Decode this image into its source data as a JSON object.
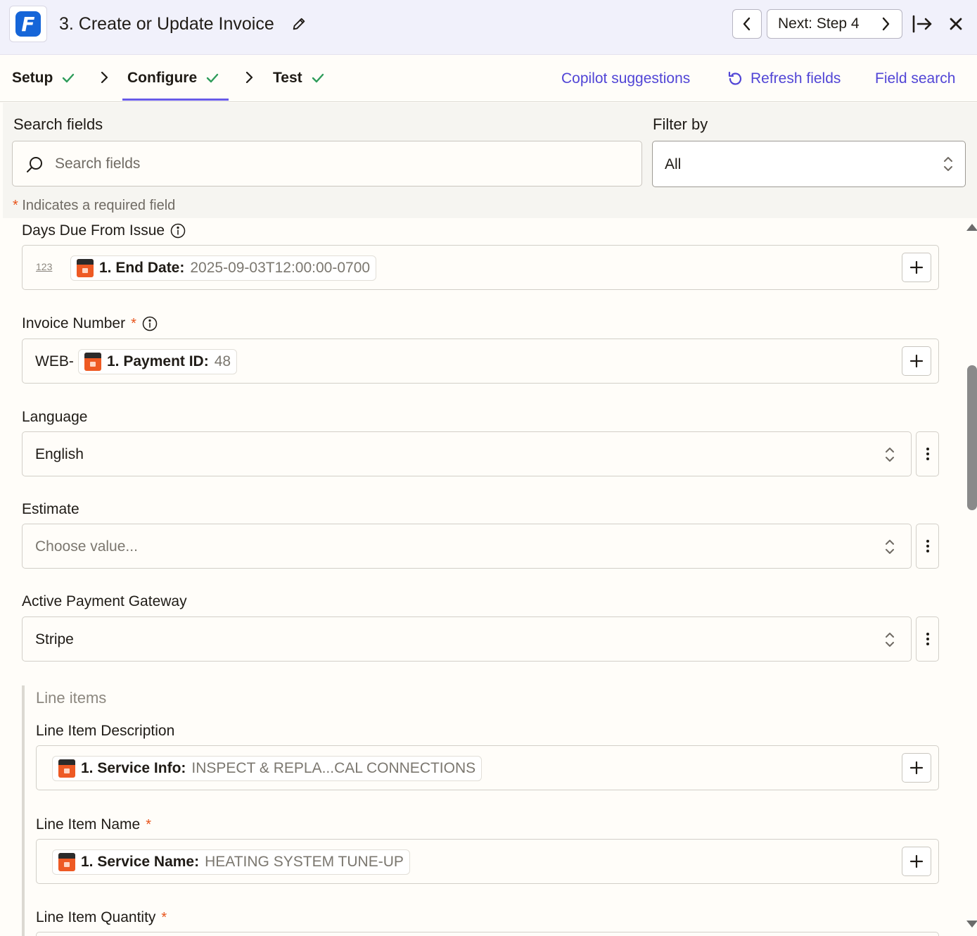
{
  "header": {
    "title": "3. Create or Update Invoice",
    "next_label": "Next: Step 4",
    "logo_letter": "F"
  },
  "tabs": {
    "setup": "Setup",
    "configure": "Configure",
    "test": "Test",
    "copilot": "Copilot suggestions",
    "refresh": "Refresh fields",
    "field_search": "Field search"
  },
  "search": {
    "label": "Search fields",
    "placeholder": "Search fields",
    "filter_label": "Filter by",
    "filter_value": "All",
    "required_note": "Indicates a required field"
  },
  "fields": {
    "days_due": {
      "label": "Days Due From Issue",
      "type_icon": "123",
      "token_key": "1. End Date:",
      "token_value": "2025-09-03T12:00:00-0700"
    },
    "invoice_number": {
      "label": "Invoice Number",
      "prefix": "WEB-",
      "token_key": "1. Payment ID:",
      "token_value": "48"
    },
    "language": {
      "label": "Language",
      "value": "English"
    },
    "estimate": {
      "label": "Estimate",
      "placeholder": "Choose value..."
    },
    "gateway": {
      "label": "Active Payment Gateway",
      "value": "Stripe"
    }
  },
  "line_items": {
    "title": "Line items",
    "description": {
      "label": "Line Item Description",
      "token_key": "1. Service Info:",
      "token_value": "INSPECT & REPLA...CAL CONNECTIONS"
    },
    "name": {
      "label": "Line Item Name",
      "token_key": "1. Service Name:",
      "token_value": "HEATING SYSTEM TUNE-UP"
    },
    "quantity": {
      "label": "Line Item Quantity"
    }
  },
  "colors": {
    "accent": "#5145d6",
    "required": "#e8541b",
    "check": "#2e9c5a",
    "app_brand": "#1565d8",
    "token_icon": "#ee5a24"
  }
}
